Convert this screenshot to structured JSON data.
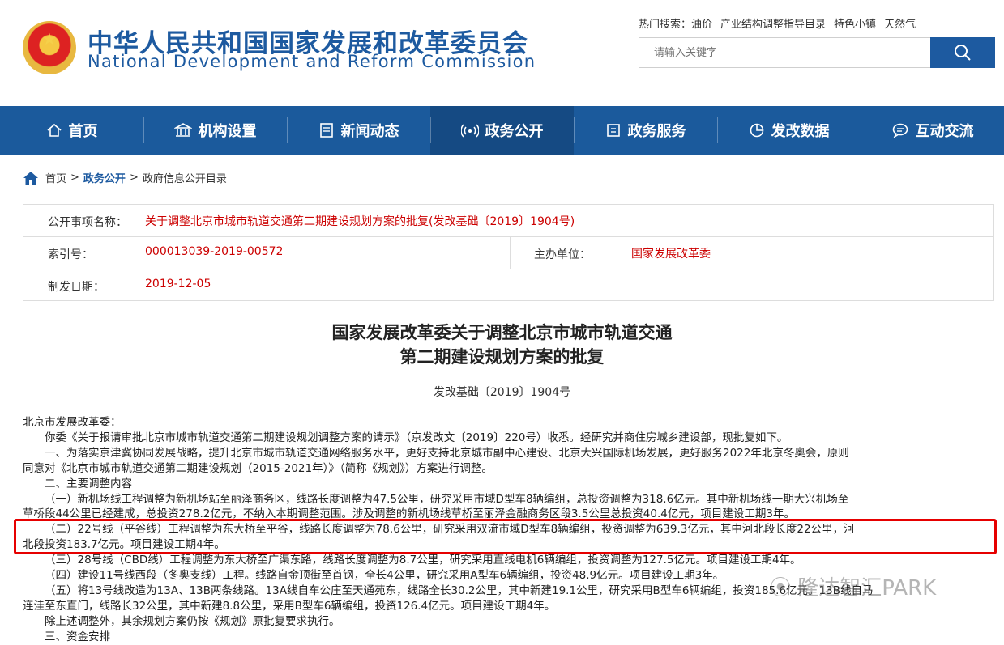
{
  "header": {
    "logo_cn": "中华人民共和国国家发展和改革委员会",
    "logo_en": "National Development and Reform Commission",
    "hot_label": "热门搜索：",
    "hot_items": [
      "油价",
      "产业结构调整指导目录",
      "特色小镇",
      "天然气"
    ],
    "search_placeholder": "请输入关键字"
  },
  "nav": {
    "items": [
      {
        "label": "首页",
        "icon": "home-icon"
      },
      {
        "label": "机构设置",
        "icon": "building-icon"
      },
      {
        "label": "新闻动态",
        "icon": "news-icon"
      },
      {
        "label": "政务公开",
        "icon": "broadcast-icon",
        "active": true
      },
      {
        "label": "政务服务",
        "icon": "service-icon"
      },
      {
        "label": "发改数据",
        "icon": "pie-chart-icon"
      },
      {
        "label": "互动交流",
        "icon": "chat-icon"
      }
    ]
  },
  "breadcrumb": {
    "home": "首页",
    "sep": ">",
    "section": "政务公开",
    "current": "政府信息公开目录"
  },
  "info": {
    "subject_label": "公开事项名称：",
    "subject_value": "关于调整北京市城市轨道交通第二期建设规划方案的批复(发改基础〔2019〕1904号)",
    "index_label": "索引号：",
    "index_value": "000013039-2019-00572",
    "unit_label": "主办单位：",
    "unit_value": "国家发展改革委",
    "date_label": "制发日期：",
    "date_value": "2019-12-05"
  },
  "document": {
    "title_line1": "国家发展改革委关于调整北京市城市轨道交通",
    "title_line2": "第二期建设规划方案的批复",
    "doc_no": "发改基础〔2019〕1904号",
    "lines": [
      "北京市发展改革委：",
      "你委《关于报请审批北京市城市轨道交通第二期建设规划调整方案的请示》（京发改文〔2019〕220号）收悉。经研究并商住房城乡建设部，现批复如下。",
      "一、为落实京津冀协同发展战略，提升北京市城市轨道交通网络服务水平，更好支持北京城市副中心建设、北京大兴国际机场发展，更好服务2022年北京冬奥会，原则",
      "同意对《北京市城市轨道交通第二期建设规划（2015-2021年）》（简称《规划》）方案进行调整。",
      "二、主要调整内容",
      "（一）新机场线工程调整为新机场站至丽泽商务区，线路长度调整为47.5公里，研究采用市域D型车8辆编组，总投资调整为318.6亿元。其中新机场线一期大兴机场至",
      "草桥段44公里已经建成，总投资278.2亿元，不纳入本期调整范围。涉及调整的新机场线草桥至丽泽金融商务区段3.5公里总投资40.4亿元，项目建设工期3年。",
      "（二）22号线（平谷线）工程调整为东大桥至平谷，线路长度调整为78.6公里，研究采用双流市域D型车8辆编组，投资调整为639.3亿元，其中河北段长度22公里，河",
      "北段投资183.7亿元。项目建设工期4年。",
      "（三）28号线（CBD线）工程调整为东大桥至广渠东路，线路长度调整为8.7公里，研究采用直线电机6辆编组，投资调整为127.5亿元。项目建设工期4年。",
      "（四）建设11号线西段（冬奥支线）工程。线路自金顶街至首钢，全长4公里，研究采用A型车6辆编组，投资48.9亿元。项目建设工期3年。",
      "（五）将13号线改造为13A、13B两条线路。13A线自车公庄至天通苑东，线路全长30.2公里，其中新建19.1公里，研究采用B型车6辆编组，投资185.6亿元。13B线自马",
      "连洼至东直门，线路长32公里，其中新建8.8公里，采用B型车6辆编组，投资126.4亿元。项目建设工期4年。",
      "除上述调整外，其余规划方案仍按《规划》原批复要求执行。",
      "三、资金安排"
    ]
  },
  "watermark": "隆达智汇PARK"
}
